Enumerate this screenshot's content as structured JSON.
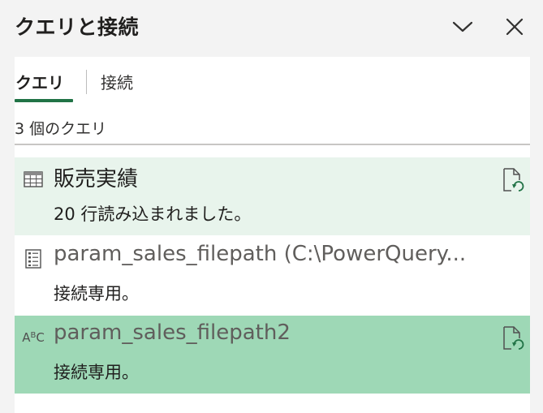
{
  "pane": {
    "title": "クエリと接続",
    "collapse_icon": "chevron-down-icon",
    "close_icon": "close-icon"
  },
  "tabs": [
    {
      "label": "クエリ",
      "active": true
    },
    {
      "label": "接続",
      "active": false
    }
  ],
  "query_count_label": "3 個のクエリ",
  "queries": [
    {
      "name": "販売実績",
      "status": "20 行読み込まれました。",
      "icon": "table-icon",
      "refresh_icon": "refresh-document-icon",
      "state": "selected-light"
    },
    {
      "name": "param_sales_filepath (C:\\PowerQuery...",
      "status": "接続専用。",
      "icon": "parameter-list-icon",
      "state": "normal"
    },
    {
      "name": "param_sales_filepath2",
      "status": "接続専用。",
      "icon": "text-type-icon",
      "refresh_icon": "refresh-document-icon",
      "state": "hover"
    }
  ],
  "colors": {
    "accent": "#217346",
    "selected_light_bg": "#e8f4ec",
    "hover_bg": "#9ed8b6",
    "refresh_arrow": "#217346"
  }
}
